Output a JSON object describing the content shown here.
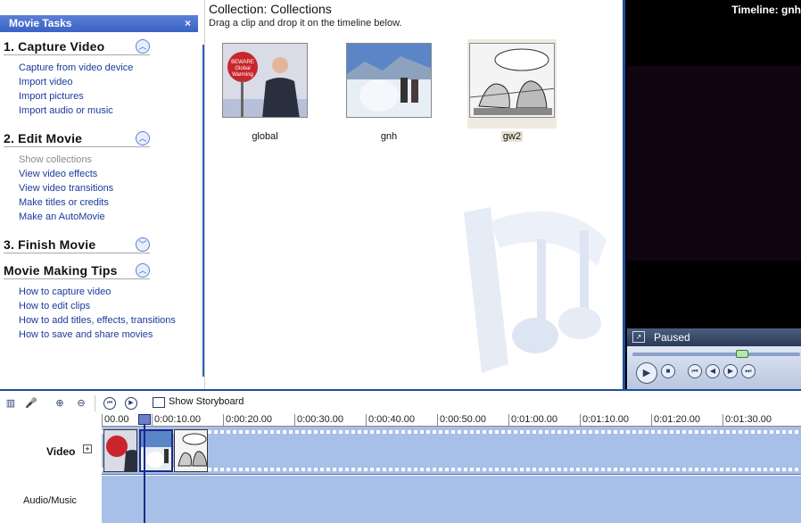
{
  "taskpane": {
    "title": "Movie Tasks",
    "close_glyph": "×",
    "sections": [
      {
        "heading": "1. Capture Video",
        "chevron": "up",
        "links": [
          "Capture from video device",
          "Import video",
          "Import pictures",
          "Import audio or music"
        ]
      },
      {
        "heading": "2. Edit Movie",
        "chevron": "up",
        "links": [
          "Show collections",
          "View video effects",
          "View video transitions",
          "Make titles or credits",
          "Make an AutoMovie"
        ]
      },
      {
        "heading": "3. Finish Movie",
        "chevron": "down",
        "links": []
      },
      {
        "heading": "Movie Making Tips",
        "chevron": "up",
        "links": [
          "How to capture video",
          "How to edit clips",
          "How to add titles, effects, transitions",
          "How to save and share movies"
        ]
      }
    ]
  },
  "collection": {
    "title": "Collection: Collections",
    "subtitle": "Drag a clip and drop it on the timeline below.",
    "clips": [
      {
        "name": "global",
        "selected": false
      },
      {
        "name": "gnh",
        "selected": false
      },
      {
        "name": "gw2",
        "selected": true
      }
    ]
  },
  "monitor": {
    "timeline_label": "Timeline: gnh",
    "status": "Paused"
  },
  "timeline": {
    "toolbar": {
      "show_storyboard": "Show Storyboard"
    },
    "ruler_ticks": [
      "00.00",
      "0:00:10.00",
      "0:00:20.00",
      "0:00:30.00",
      "0:00:40.00",
      "0:00:50.00",
      "0:01:00.00",
      "0:01:10.00",
      "0:01:20.00",
      "0:01:30.00"
    ],
    "tracks": {
      "video": "Video",
      "audio": "Audio/Music"
    }
  },
  "colors": {
    "accent": "#2d5fb3",
    "track": "#a8bfe8",
    "link": "#1a3a9a"
  }
}
